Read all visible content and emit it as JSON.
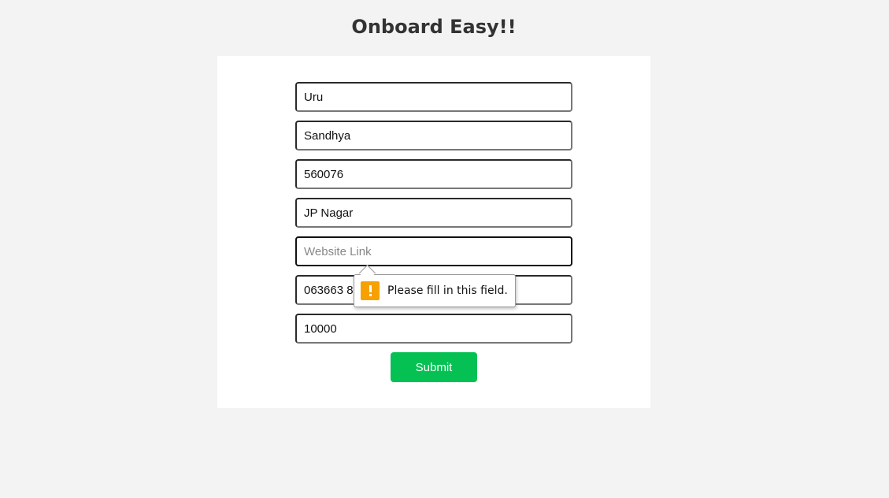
{
  "header": {
    "title": "Onboard Easy!!"
  },
  "form": {
    "fields": [
      {
        "value": "Uru",
        "placeholder": ""
      },
      {
        "value": "Sandhya",
        "placeholder": ""
      },
      {
        "value": "560076",
        "placeholder": ""
      },
      {
        "value": "JP Nagar",
        "placeholder": ""
      },
      {
        "value": "",
        "placeholder": "Website Link"
      },
      {
        "value": "063663 8",
        "placeholder": ""
      },
      {
        "value": "10000",
        "placeholder": ""
      }
    ],
    "submit_label": "Submit"
  },
  "validation": {
    "message": "Please fill in this field.",
    "icon": "warning-icon"
  },
  "colors": {
    "background": "#f3f3f3",
    "card": "#ffffff",
    "submit": "#05c153",
    "warning": "#f7a100"
  }
}
